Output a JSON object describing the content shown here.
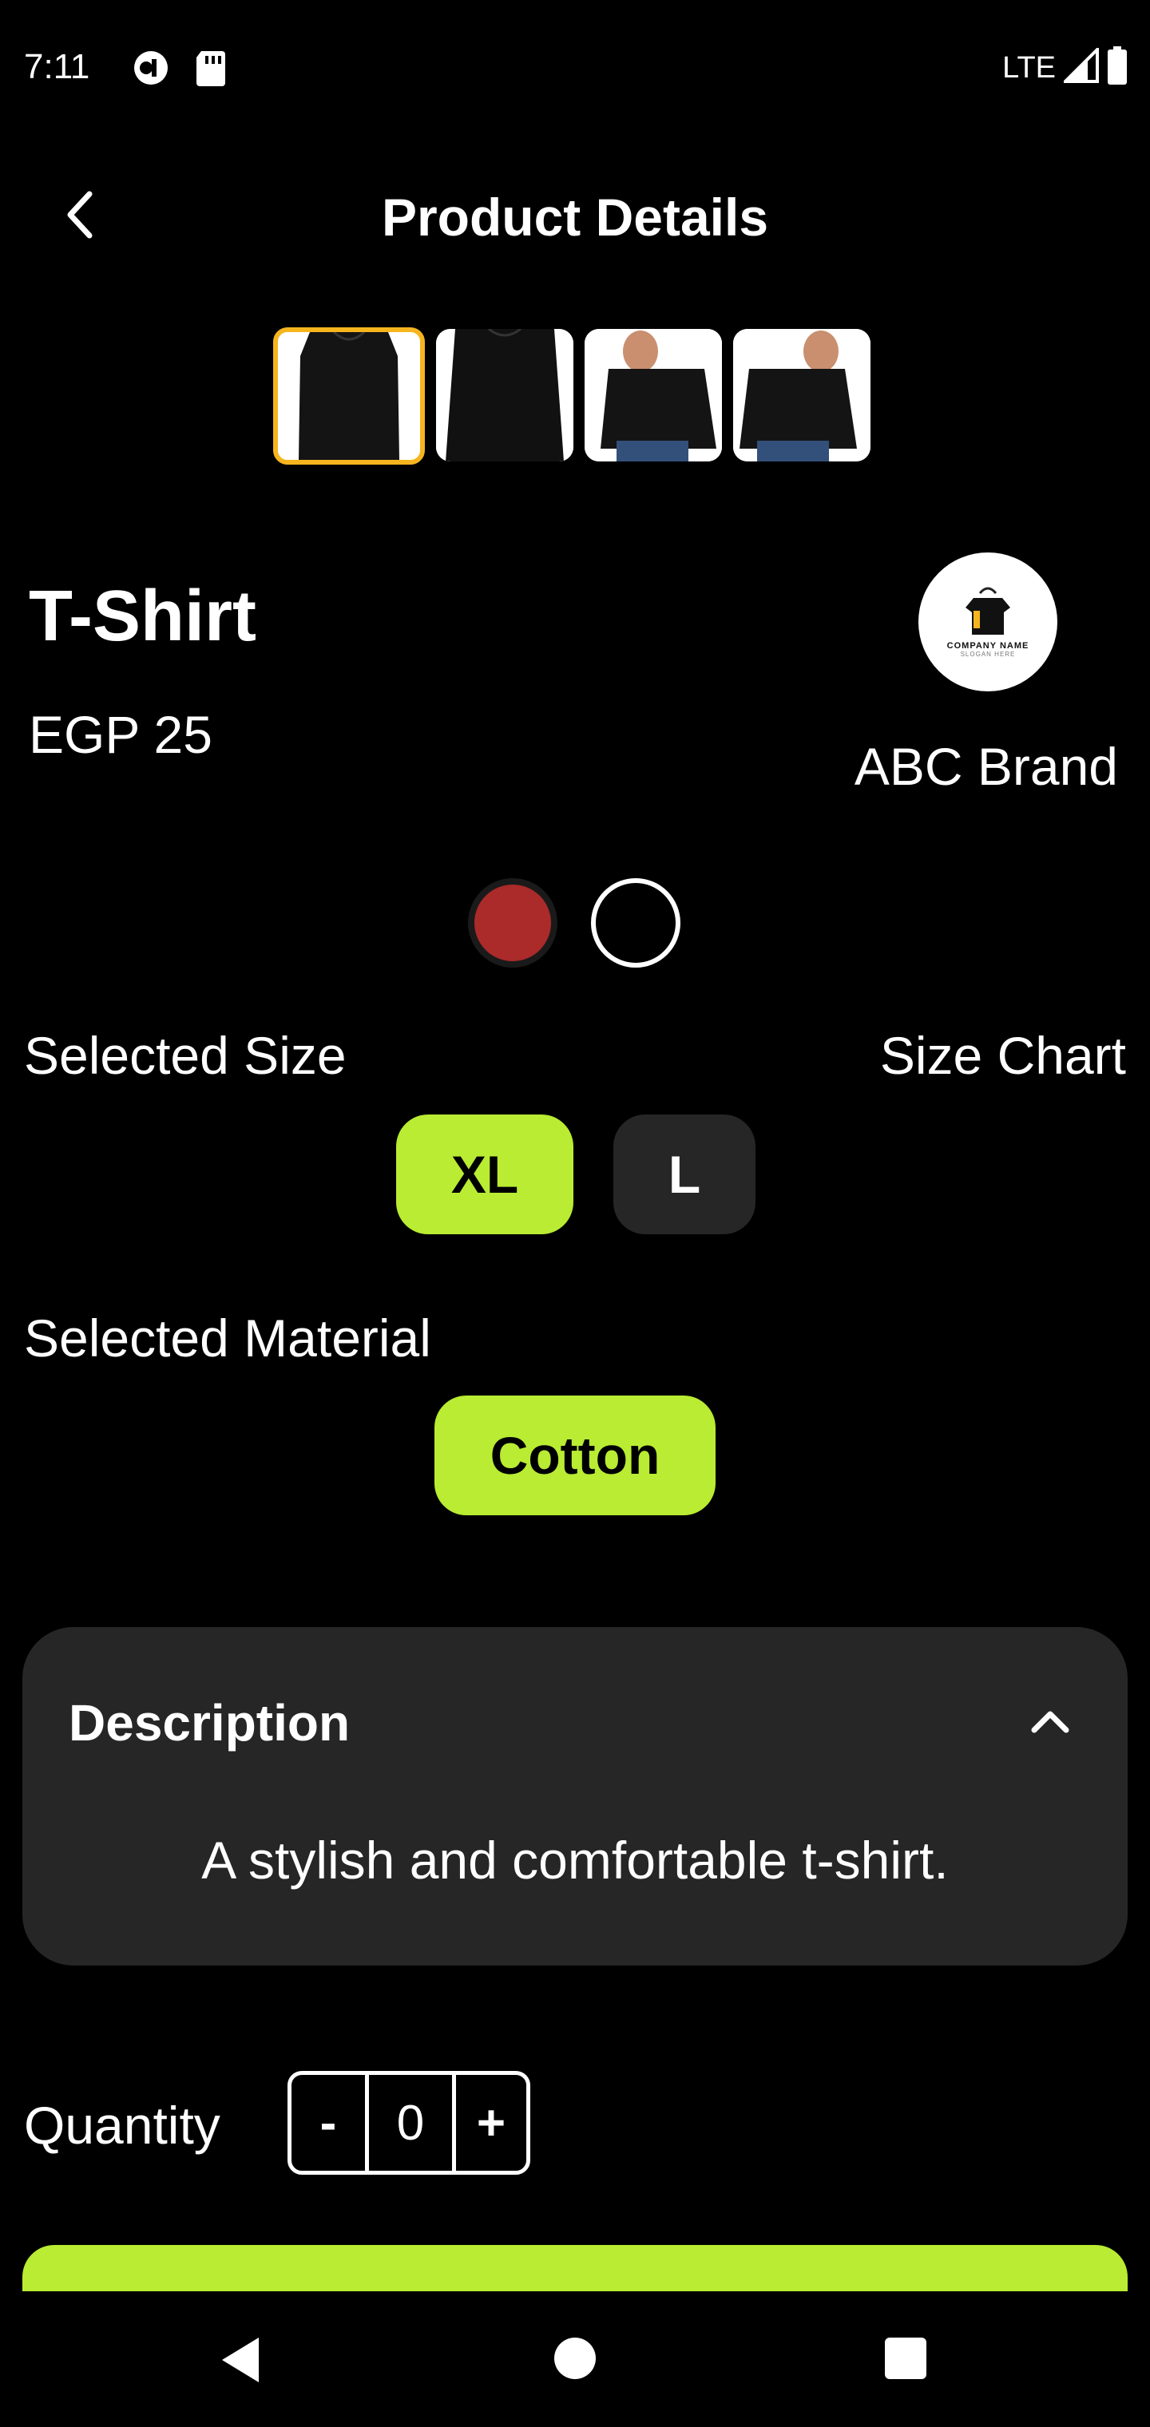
{
  "status_bar": {
    "time": "7:11",
    "network": "LTE",
    "icons": [
      "app-notification-icon",
      "sd-card-icon",
      "signal-icon",
      "battery-icon"
    ]
  },
  "header": {
    "title": "Product Details",
    "back_icon": "chevron-left-icon"
  },
  "gallery": {
    "thumbnail_count": 4,
    "selected_index": 0,
    "selected_border_color": "#f5b51e"
  },
  "product": {
    "name": "T-Shirt",
    "price": "EGP 25"
  },
  "brand": {
    "name": "ABC Brand",
    "logo_text": "COMPANY NAME",
    "logo_slogan": "SLOGAN HERE"
  },
  "colors": {
    "options": [
      "#ab2a2a",
      "#000000"
    ],
    "selected_index": 1
  },
  "size": {
    "label": "Selected Size",
    "chart_link": "Size Chart",
    "options": [
      "XL",
      "L"
    ],
    "selected": "XL"
  },
  "material": {
    "label": "Selected Material",
    "options": [
      "Cotton"
    ],
    "selected": "Cotton"
  },
  "description": {
    "title": "Description",
    "text": "A stylish and comfortable t-shirt.",
    "expanded": true
  },
  "quantity": {
    "label": "Quantity",
    "decrement": "-",
    "value": "0",
    "increment": "+"
  },
  "theme": {
    "accent": "#b9ec32",
    "card": "#262626",
    "background": "#000000"
  }
}
